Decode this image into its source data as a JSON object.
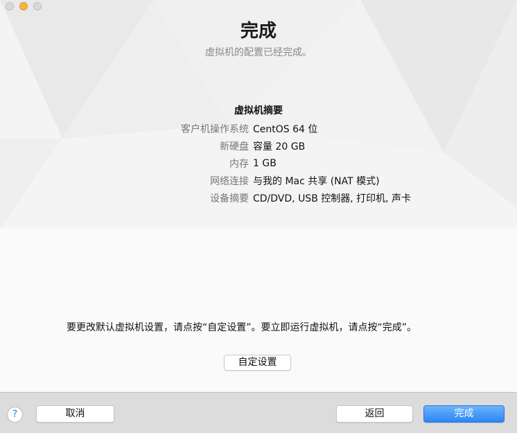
{
  "window": {
    "title": "完成",
    "subtitle": "虚拟机的配置已经完成。"
  },
  "summary": {
    "heading": "虚拟机摘要",
    "rows": [
      {
        "label": "客户机操作系统",
        "value": "CentOS 64 位"
      },
      {
        "label": "新硬盘",
        "value": "容量 20 GB"
      },
      {
        "label": "内存",
        "value": "1 GB"
      },
      {
        "label": "网络连接",
        "value": "与我的 Mac 共享 (NAT 模式)"
      },
      {
        "label": "设备摘要",
        "value": "CD/DVD, USB 控制器, 打印机, 声卡"
      }
    ]
  },
  "note": "要更改默认虚拟机设置，请点按“自定设置”。要立即运行虚拟机，请点按“完成”。",
  "buttons": {
    "customize": "自定设置",
    "help": "?",
    "cancel": "取消",
    "back": "返回",
    "finish": "完成"
  },
  "colors": {
    "accent": "#2b86f4",
    "min_light": "#f5b43a"
  }
}
